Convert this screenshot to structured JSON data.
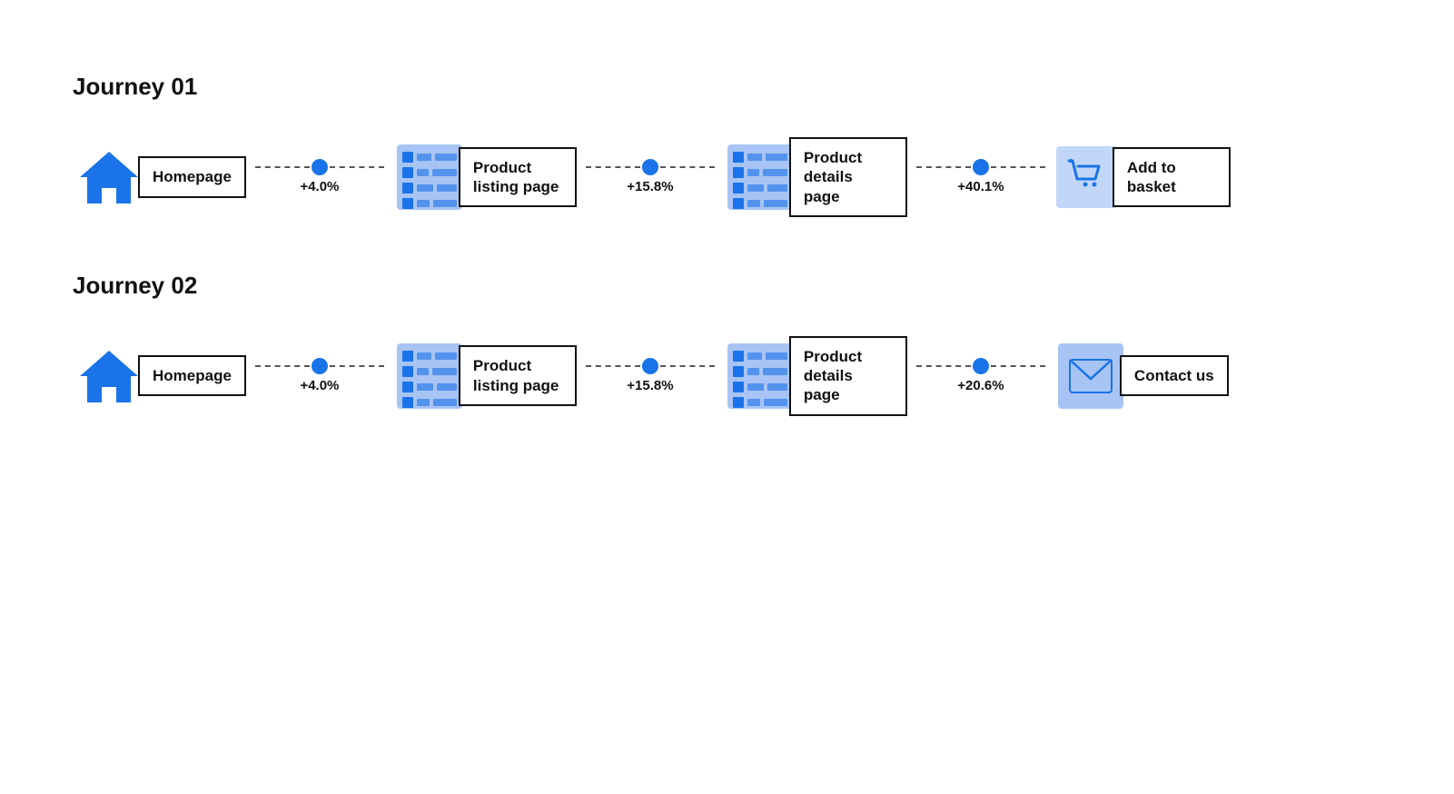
{
  "journeys": [
    {
      "id": "journey-01",
      "title": "Journey 01",
      "nodes": [
        {
          "id": "homepage-1",
          "icon": "home",
          "label": "Homepage"
        },
        {
          "id": "product-listing-1",
          "icon": "list-page",
          "label": "Product listing page"
        },
        {
          "id": "product-details-1",
          "icon": "list-page",
          "label": "Product details page"
        },
        {
          "id": "add-to-basket-1",
          "icon": "cart",
          "label": "Add to basket"
        }
      ],
      "connectors": [
        {
          "pct": "+4.0%"
        },
        {
          "pct": "+15.8%"
        },
        {
          "pct": "+40.1%"
        }
      ]
    },
    {
      "id": "journey-02",
      "title": "Journey 02",
      "nodes": [
        {
          "id": "homepage-2",
          "icon": "home",
          "label": "Homepage"
        },
        {
          "id": "product-listing-2",
          "icon": "list-page",
          "label": "Product listing page"
        },
        {
          "id": "product-details-2",
          "icon": "list-page",
          "label": "Product details page"
        },
        {
          "id": "contact-us-2",
          "icon": "envelope",
          "label": "Contact us"
        }
      ],
      "connectors": [
        {
          "pct": "+4.0%"
        },
        {
          "pct": "+15.8%"
        },
        {
          "pct": "+20.6%"
        }
      ]
    }
  ]
}
